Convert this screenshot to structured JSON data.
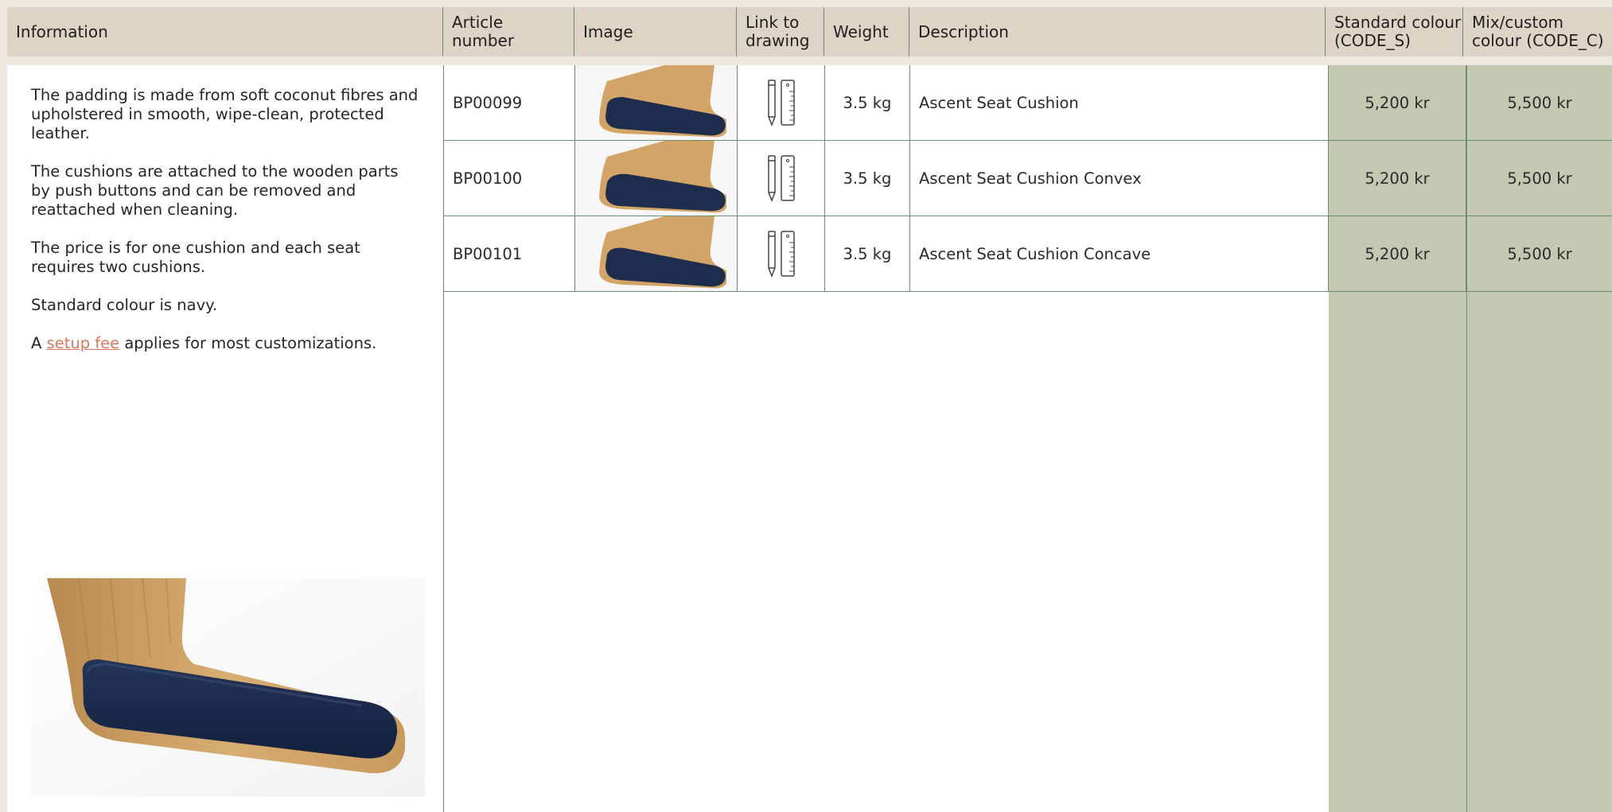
{
  "header": {
    "information": "Information",
    "article_number": "Article\nnumber",
    "image": "Image",
    "link_to_drawing": "Link to\ndrawing",
    "weight": "Weight",
    "description": "Description",
    "standard_colour": "Standard colour\n(CODE_S)",
    "mix_custom_colour": "Mix/custom\ncolour (CODE_C)"
  },
  "info": {
    "p1": "The padding is made from soft coconut fibres and upholstered in smooth, wipe-clean, protected leather.",
    "p2": "The cushions are attached to the wooden parts by push buttons and can be removed and reattached when cleaning.",
    "p3": "The price is for one cushion and each seat requires two cushions.",
    "p4": "Standard colour is navy.",
    "p5_prefix": "A ",
    "p5_link": "setup fee",
    "p5_suffix": " applies for most customizations.",
    "photo_icon": "seat-cushion-photo"
  },
  "rows": [
    {
      "article": "BP00099",
      "weight": "3.5 kg",
      "description": "Ascent Seat Cushion",
      "standard_price": "5,200 kr",
      "custom_price": "5,500 kr"
    },
    {
      "article": "BP00100",
      "weight": "3.5 kg",
      "description": "Ascent Seat Cushion Convex",
      "standard_price": "5,200 kr",
      "custom_price": "5,500 kr"
    },
    {
      "article": "BP00101",
      "weight": "3.5 kg",
      "description": "Ascent Seat Cushion Concave",
      "standard_price": "5,200 kr",
      "custom_price": "5,500 kr"
    }
  ],
  "icons": {
    "drawing": "pencil-ruler-icon",
    "thumbnail": "seat-cushion-thumbnail"
  },
  "colors": {
    "header_bg": "#ded4c5",
    "price_column_bg": "#c2c9b0",
    "link": "#d9785c",
    "border": "#6f8a78"
  }
}
